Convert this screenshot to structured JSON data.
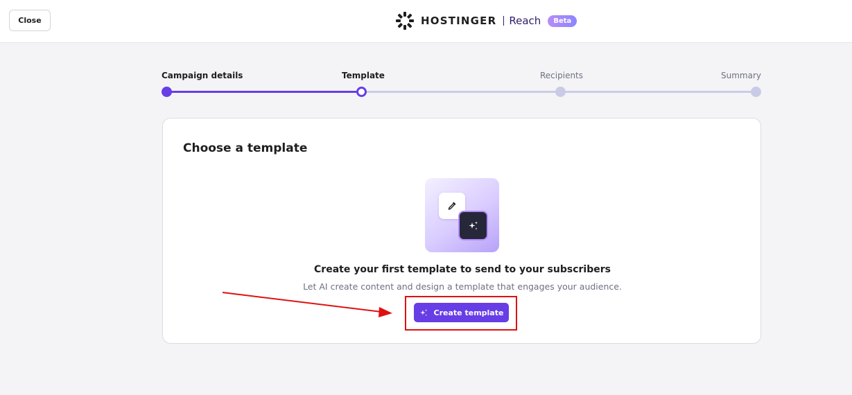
{
  "header": {
    "close_label": "Close",
    "brand_name": "HOSTINGER",
    "product_name": "Reach",
    "badge": "Beta"
  },
  "stepper": {
    "steps": [
      {
        "label": "Campaign details",
        "state": "done"
      },
      {
        "label": "Template",
        "state": "active"
      },
      {
        "label": "Recipients",
        "state": "pending"
      },
      {
        "label": "Summary",
        "state": "pending"
      }
    ]
  },
  "card": {
    "title": "Choose a template",
    "empty_heading": "Create your first template to send to your subscribers",
    "empty_sub": "Let AI create content and design a template that engages your audience.",
    "create_button": "Create template"
  },
  "icons": {
    "brand": "hostinger-logo-icon",
    "picker": "color-picker-icon",
    "sparkle": "sparkle-icon"
  },
  "colors": {
    "accent": "#673de6",
    "annotation": "#e01010",
    "page_bg": "#f4f4f7"
  }
}
